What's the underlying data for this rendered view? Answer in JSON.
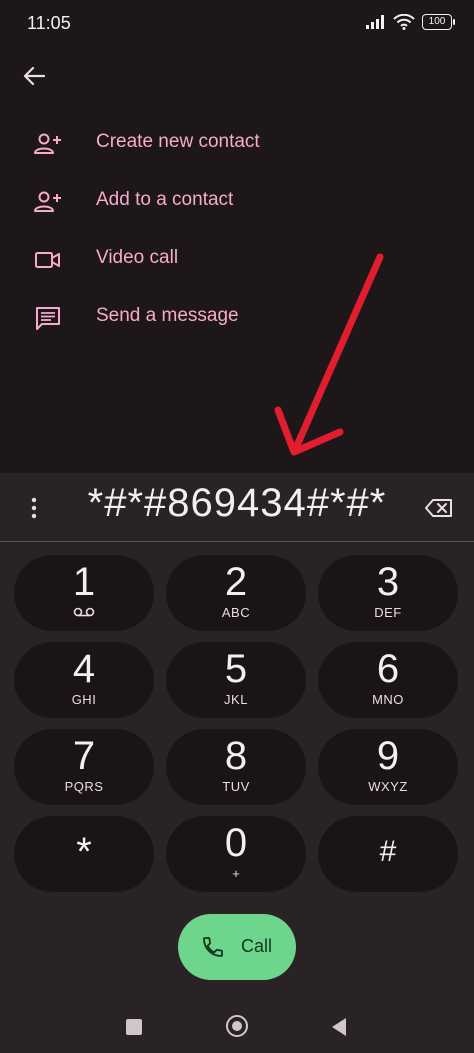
{
  "status_bar": {
    "time": "11:05",
    "battery": "100"
  },
  "actions": [
    {
      "label": "Create new contact",
      "icon": "person-add-icon"
    },
    {
      "label": "Add to a contact",
      "icon": "person-add-icon"
    },
    {
      "label": "Video call",
      "icon": "videocam-icon"
    },
    {
      "label": "Send a message",
      "icon": "message-icon"
    }
  ],
  "dialer": {
    "number": "*#*#869434#*#*",
    "keys": [
      {
        "digit": "1",
        "sub": ""
      },
      {
        "digit": "2",
        "sub": "ABC"
      },
      {
        "digit": "3",
        "sub": "DEF"
      },
      {
        "digit": "4",
        "sub": "GHI"
      },
      {
        "digit": "5",
        "sub": "JKL"
      },
      {
        "digit": "6",
        "sub": "MNO"
      },
      {
        "digit": "7",
        "sub": "PQRS"
      },
      {
        "digit": "8",
        "sub": "TUV"
      },
      {
        "digit": "9",
        "sub": "WXYZ"
      },
      {
        "digit": "*",
        "sub": ""
      },
      {
        "digit": "0",
        "sub": "+"
      },
      {
        "digit": "#",
        "sub": ""
      }
    ],
    "call_label": "Call"
  },
  "colors": {
    "accent_pink": "#f7aacb",
    "call_green": "#6dd58c",
    "annotation_red": "#e11d2e"
  }
}
